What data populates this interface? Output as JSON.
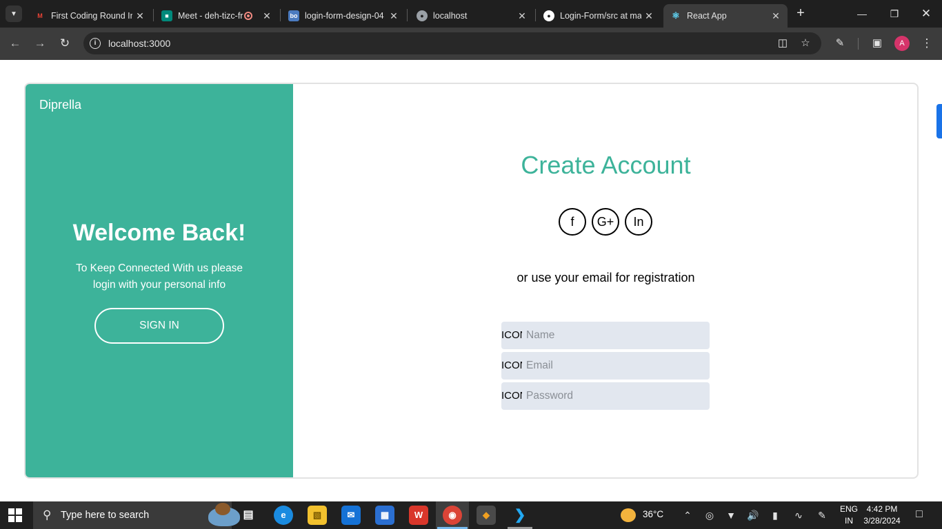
{
  "browser": {
    "tabs": [
      {
        "title": "First Coding Round In",
        "favicon": "gmail-icon",
        "color": "#ea4335"
      },
      {
        "title": "Meet - deh-tizc-fr",
        "favicon": "meet-icon",
        "color": "#00897b"
      },
      {
        "title": "login-form-design-04",
        "favicon": "bo-icon",
        "color": "#4b7bbf"
      },
      {
        "title": "localhost",
        "favicon": "globe-icon",
        "color": "#9aa0a6"
      },
      {
        "title": "Login-Form/src at ma",
        "favicon": "github-icon",
        "color": "#ffffff"
      },
      {
        "title": "React App",
        "favicon": "react-icon",
        "color": "#61dafb"
      }
    ],
    "url": "localhost:3000",
    "profile_initial": "A"
  },
  "left_panel": {
    "brand": "Diprella",
    "heading": "Welcome Back!",
    "subtext": "To Keep Connected With us please login with your personal info",
    "button_label": "SIGN IN",
    "background": "#3db39a"
  },
  "right_panel": {
    "heading": "Create Account",
    "social": [
      {
        "label": "f",
        "icon": "facebook-icon"
      },
      {
        "label": "G+",
        "icon": "google-plus-icon"
      },
      {
        "label": "In",
        "icon": "linkedin-icon"
      }
    ],
    "divider_text": "or use your email for registration",
    "fields": [
      {
        "icon_text": "ICON",
        "placeholder": "Name",
        "value": ""
      },
      {
        "icon_text": "ICON",
        "placeholder": "Email",
        "value": ""
      },
      {
        "icon_text": "ICON",
        "placeholder": "Password",
        "value": ""
      }
    ],
    "accent": "#3db39a"
  },
  "taskbar": {
    "search_placeholder": "Type here to search",
    "weather": "36°C",
    "lang_line1": "ENG",
    "lang_line2": "IN",
    "time": "4:42 PM",
    "date": "3/28/2024"
  }
}
